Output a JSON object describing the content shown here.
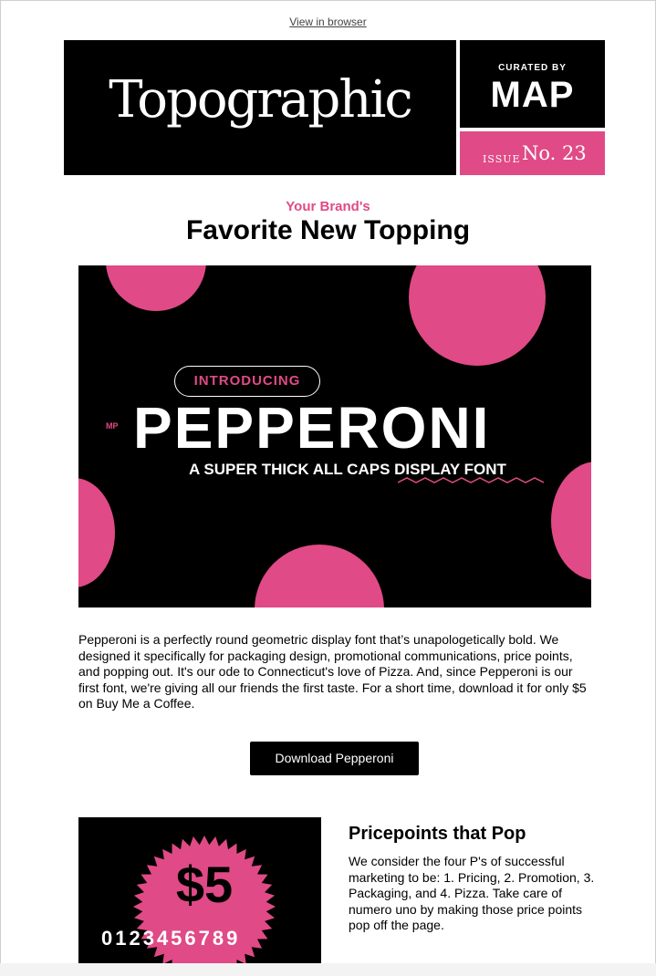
{
  "header": {
    "view_in_browser": "View in browser",
    "logo": "Topographic",
    "curated_by": "CURATED BY",
    "map": "MAP",
    "issue_word": "ISSUE",
    "issue_number": "No. 23"
  },
  "intro": {
    "kicker": "Your Brand's",
    "headline": "Favorite New Topping"
  },
  "hero": {
    "pill": "INTRODUCING",
    "mp": "MP",
    "title": "PEPPERONI",
    "subtitle": "A SUPER THICK ALL CAPS DISPLAY FONT"
  },
  "body": {
    "paragraph": "Pepperoni is a perfectly round geometric display font that’s unapologetically bold. We designed it specifically for packaging design, promotional communications, price points, and popping out. It's our ode to Connecticut's love of Pizza. And, since Pepperoni is our first font, we're giving all our friends the first taste. For a short time, download it for only $5 on Buy Me a Coffee.",
    "cta_label": "Download Pepperoni"
  },
  "promo": {
    "price": "$5",
    "digits": "0123456789",
    "title": "Pricepoints that Pop",
    "text": "We consider the four P's of successful marketing to be: 1. Pricing, 2. Promotion, 3. Packaging, and 4. Pizza. Take care of numero uno by making those price points pop off the page."
  },
  "colors": {
    "accent_pink": "#e04a86",
    "black": "#000000",
    "white": "#ffffff"
  }
}
